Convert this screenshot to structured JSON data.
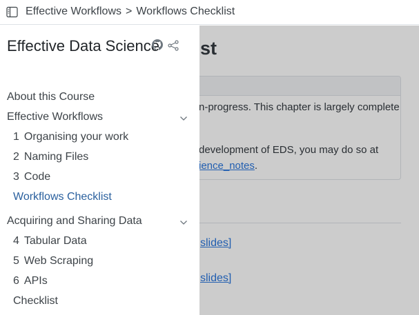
{
  "breadcrumb": {
    "items": [
      "Effective Workflows",
      "Workflows Checklist"
    ],
    "separator": ">"
  },
  "page": {
    "title_partial": "st",
    "callout_line1": "n-progress. This chapter is largely complete",
    "callout_line2": "development of EDS, you may do so at",
    "callout_link": "ience_notes",
    "callout_link_tail": ".",
    "slides_link_1": "slides]",
    "slides_link_2": "slides]"
  },
  "sidebar": {
    "title": "Effective Data Science",
    "about": "About this Course",
    "sections": [
      {
        "label": "Effective Workflows",
        "items": [
          {
            "num": "1",
            "label": "Organising your work"
          },
          {
            "num": "2",
            "label": "Naming Files"
          },
          {
            "num": "3",
            "label": "Code"
          },
          {
            "num": "",
            "label": "Workflows Checklist"
          }
        ]
      },
      {
        "label": "Acquiring and Sharing Data",
        "items": [
          {
            "num": "4",
            "label": "Tabular Data"
          },
          {
            "num": "5",
            "label": "Web Scraping"
          },
          {
            "num": "6",
            "label": "APIs"
          },
          {
            "num": "",
            "label": "Checklist"
          }
        ]
      }
    ]
  },
  "icons": {
    "toc_toggle": "sidebar-toggle-icon",
    "github": "github-icon",
    "share": "share-icon",
    "chevron": "chevron-down-icon"
  },
  "colors": {
    "active_link": "#2a609e",
    "link": "#2a76dd",
    "text": "#3d4348",
    "overlay": "rgba(0,0,0,0.2)"
  }
}
